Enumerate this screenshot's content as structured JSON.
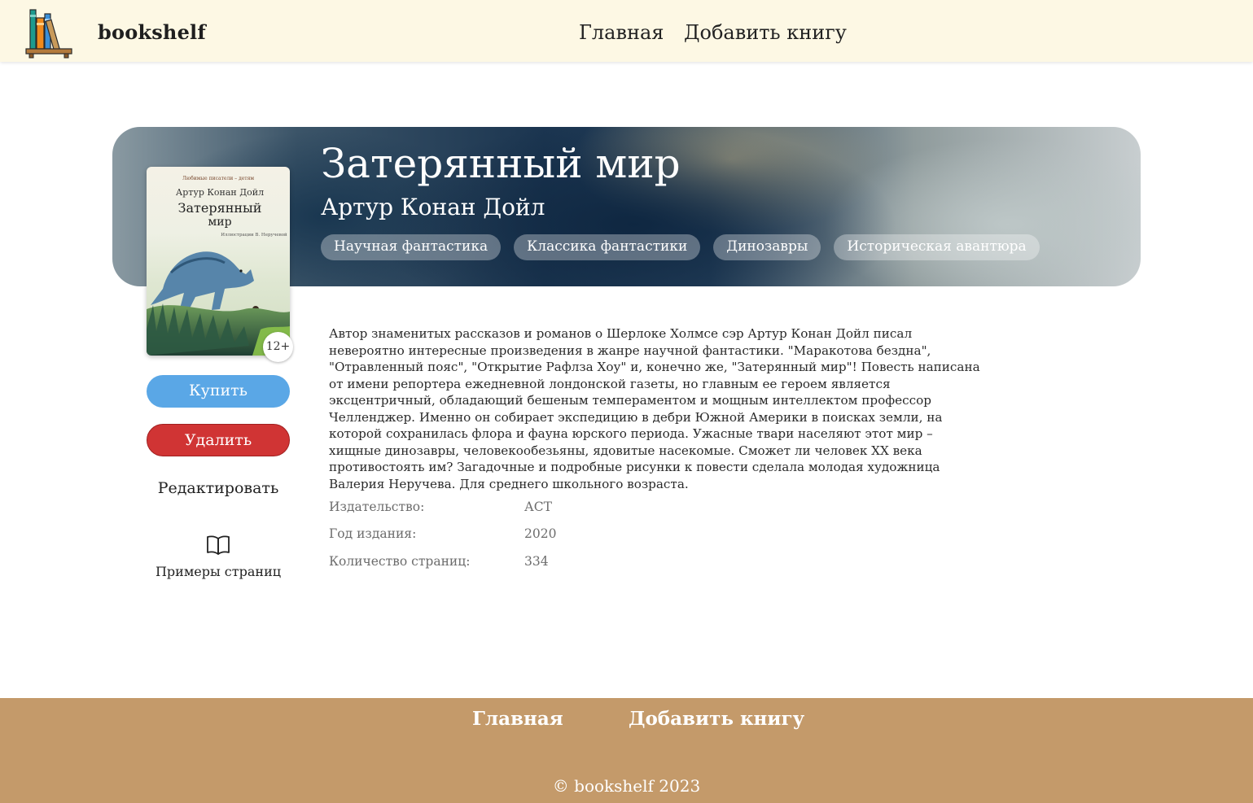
{
  "header": {
    "brand": "bookshelf",
    "nav": [
      {
        "label": "Главная"
      },
      {
        "label": "Добавить книгу"
      }
    ]
  },
  "book": {
    "title": "Затерянный мир",
    "author": "Артур Конан Дойл",
    "tags": [
      "Научная фантастика",
      "Классика фантастики",
      "Динозавры",
      "Историческая авантюра"
    ],
    "cover": {
      "series": "Любимые писатели – детям",
      "author": "Артур Конан Дойл",
      "title_line1": "Затерянный",
      "title_line2": "мир",
      "illustrator": "Иллюстрации В. Неручевой"
    },
    "age_rating": "12+",
    "description": "Автор знаменитых рассказов и романов о Шерлоке Холмсе сэр Артур Конан Дойл писал невероятно интересные произведения в жанре научной фантастики. \"Маракотова бездна\", \"Отравленный пояс\", \"Открытие Рафлза Хоу\" и, конечно же, \"Затерянный мир\"! Повесть написана от имени репортера ежедневной лондонской газеты, но главным ее героем является эксцентричный, обладающий бешеным темпераментом и мощным интеллектом профессор Челленджер. Именно он собирает экспедицию в дебри Южной Америки в поисках земли, на которой сохранилась флора и фауна юрского периода. Ужасные твари населяют этот мир – хищные динозавры, человекообезьяны, ядовитые насекомые. Сможет ли человек XX века противостоять им? Загадочные и подробные рисунки к повести сделала молодая художница Валерия Неручева. Для среднего школьного возраста.",
    "details": [
      {
        "label": "Издательство:",
        "value": "АСТ"
      },
      {
        "label": "Год издания:",
        "value": "2020"
      },
      {
        "label": "Количество страниц:",
        "value": "334"
      }
    ]
  },
  "actions": {
    "buy": "Купить",
    "delete": "Удалить",
    "edit": "Редактировать",
    "samples": "Примеры страниц",
    "samples_icon": "open-book-icon"
  },
  "footer": {
    "nav": [
      {
        "label": "Главная"
      },
      {
        "label": "Добавить книгу"
      }
    ],
    "copyright": "© bookshelf  2023"
  },
  "colors": {
    "header_bg": "#fdf8e4",
    "footer_bg": "#c49a6a",
    "buy_button": "#5aa7e6",
    "delete_button": "#d03434"
  }
}
